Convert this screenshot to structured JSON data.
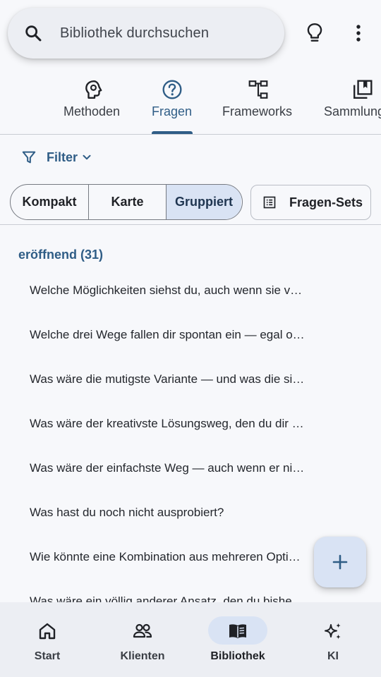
{
  "search": {
    "placeholder": "Bibliothek durchsuchen"
  },
  "tabs": [
    {
      "label": "Methoden",
      "icon": "brain-gear-icon",
      "active": false
    },
    {
      "label": "Fragen",
      "icon": "question-circle-icon",
      "active": true
    },
    {
      "label": "Frameworks",
      "icon": "hierarchy-icon",
      "active": false
    },
    {
      "label": "Sammlung",
      "icon": "collection-icon",
      "active": false
    }
  ],
  "filter": {
    "label": "Filter"
  },
  "view_modes": [
    {
      "label": "Kompakt",
      "selected": false
    },
    {
      "label": "Karte",
      "selected": false
    },
    {
      "label": "Gruppiert",
      "selected": true
    }
  ],
  "sets_button": {
    "label": "Fragen-Sets"
  },
  "group": {
    "title": "eröffnend (31)"
  },
  "questions": [
    "Welche Möglichkeiten siehst du, auch wenn sie v…",
    "Welche drei Wege fallen dir spontan ein — egal o…",
    "Was wäre die mutigste Variante — und was die si…",
    "Was wäre der kreativste Lösungsweg, den du dir …",
    "Was wäre der einfachste Weg — auch wenn er ni…",
    "Was hast du noch nicht ausprobiert?",
    "Wie könnte eine Kombination aus mehreren Opti…",
    "Was wäre ein völlig anderer Ansatz, den du bishe…"
  ],
  "bottom_nav": [
    {
      "label": "Start",
      "icon": "home-icon",
      "active": false
    },
    {
      "label": "Klienten",
      "icon": "people-icon",
      "active": false
    },
    {
      "label": "Bibliothek",
      "icon": "book-icon",
      "active": true
    },
    {
      "label": "KI",
      "icon": "sparkle-icon",
      "active": false
    }
  ],
  "colors": {
    "accent": "#2f5d86",
    "selected_bg": "#d9e3f4",
    "surface": "#eceef3",
    "background": "#f7f8fb"
  }
}
